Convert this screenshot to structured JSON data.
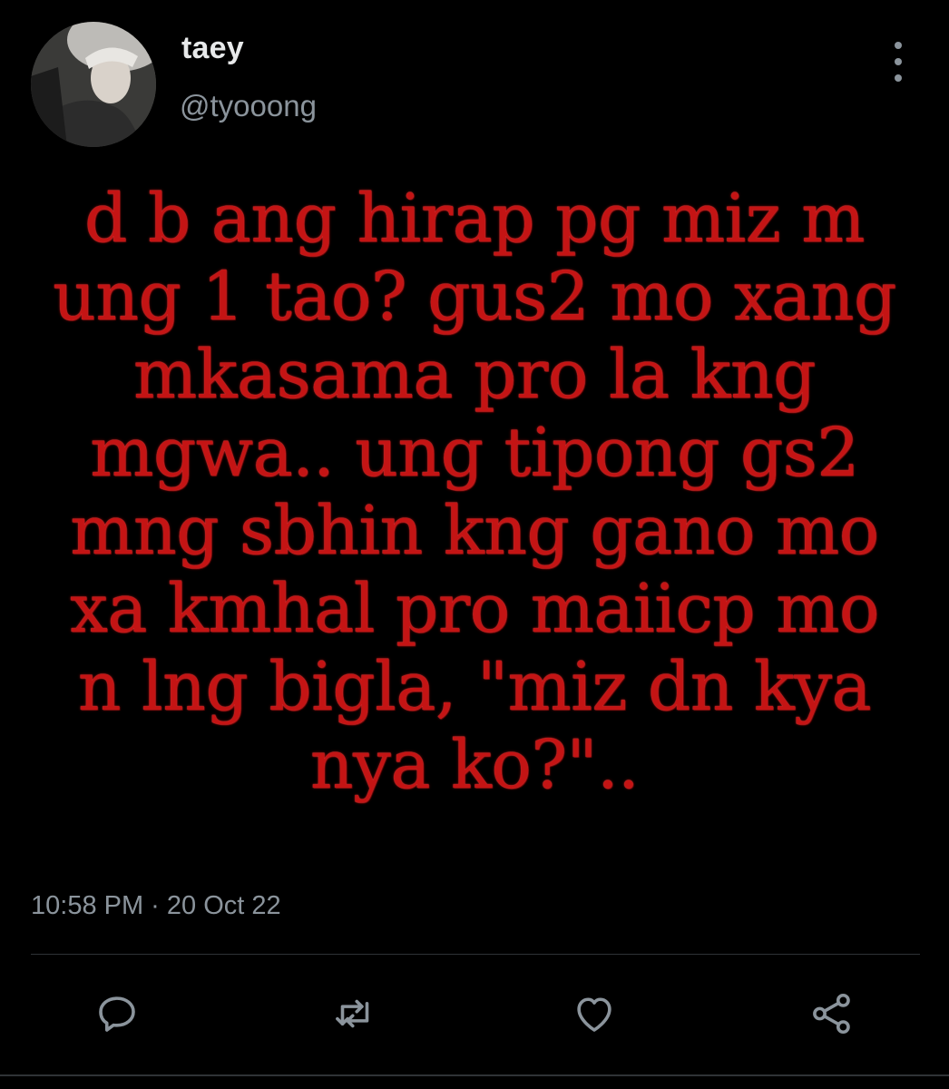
{
  "author": {
    "display_name": "taey",
    "handle": "@tyooong"
  },
  "image_text_lines": [
    "d b ang hirap pg miz m",
    "ung 1 tao? gus2 mo xang",
    "mkasama pro la kng",
    "mgwa.. ung tipong gs2",
    "mng sbhin kng gano mo",
    "xa kmhal pro maiicp mo",
    "n lng bigla, \"miz dn kya",
    "nya ko?\".."
  ],
  "timestamp": "10:58 PM · 20 Oct 22",
  "actions": {
    "reply_icon": "reply-icon",
    "retweet_icon": "retweet-icon",
    "like_icon": "heart-icon",
    "share_icon": "share-icon"
  },
  "colors": {
    "background": "#000000",
    "primary_text": "#e7e9ea",
    "secondary_text": "#8b949c",
    "image_text": "#c41414",
    "divider": "#2f3336"
  }
}
